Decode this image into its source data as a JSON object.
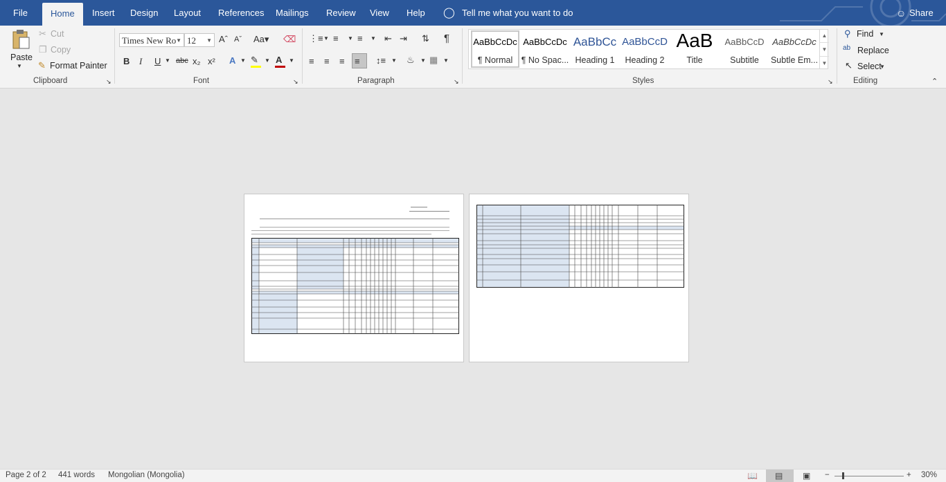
{
  "tabs": [
    "File",
    "Home",
    "Insert",
    "Design",
    "Layout",
    "References",
    "Mailings",
    "Review",
    "View",
    "Help"
  ],
  "active_tab": "Home",
  "tell_me": "Tell me what you want to do",
  "share": "Share",
  "clipboard": {
    "paste": "Paste",
    "cut": "Cut",
    "copy": "Copy",
    "format_painter": "Format Painter",
    "label": "Clipboard"
  },
  "font": {
    "name": "Times New Ro",
    "size": "12",
    "label": "Font"
  },
  "paragraph": {
    "label": "Paragraph"
  },
  "styles": {
    "label": "Styles",
    "items": [
      {
        "preview": "AaBbCcDc",
        "name": "¶ Normal"
      },
      {
        "preview": "AaBbCcDc",
        "name": "¶ No Spac..."
      },
      {
        "preview": "AaBbCc",
        "name": "Heading 1"
      },
      {
        "preview": "AaBbCcD",
        "name": "Heading 2"
      },
      {
        "preview": "AaB",
        "name": "Title"
      },
      {
        "preview": "AaBbCcD",
        "name": "Subtitle"
      },
      {
        "preview": "AaBbCcDc",
        "name": "Subtle Em..."
      }
    ]
  },
  "editing": {
    "find": "Find",
    "replace": "Replace",
    "select": "Select",
    "label": "Editing"
  },
  "status": {
    "page": "Page 2 of 2",
    "words": "441 words",
    "language": "Mongolian (Mongolia)",
    "zoom": "30%"
  },
  "colors": {
    "accent": "#2b579a",
    "ribbon": "#f3f3f3",
    "canvas": "#e6e6e6"
  }
}
